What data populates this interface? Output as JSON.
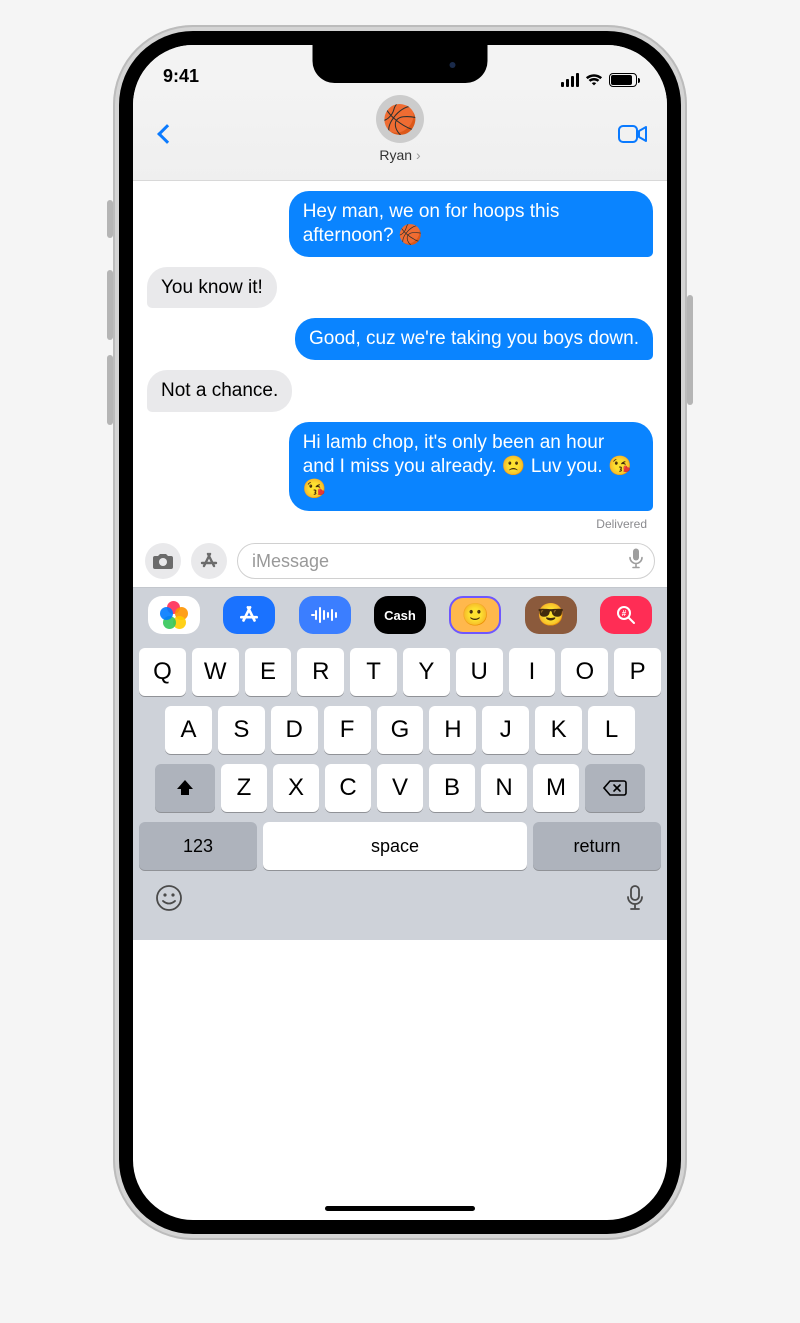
{
  "status": {
    "time": "9:41"
  },
  "header": {
    "contact_name": "Ryan",
    "avatar_emoji": "🏀"
  },
  "messages": [
    {
      "side": "sent",
      "text": "Hey man, we on for hoops this afternoon? 🏀"
    },
    {
      "side": "recv",
      "text": "You know it!"
    },
    {
      "side": "sent",
      "text": "Good, cuz we're taking you boys down."
    },
    {
      "side": "recv",
      "text": "Not a chance."
    },
    {
      "side": "sent",
      "text": "Hi lamb chop, it's only been an hour and I miss you already. 🙁 Luv you. 😘😘"
    }
  ],
  "delivered_label": "Delivered",
  "input": {
    "placeholder": "iMessage"
  },
  "app_strip": {
    "cash_label": "Cash"
  },
  "keyboard": {
    "row1": [
      "Q",
      "W",
      "E",
      "R",
      "T",
      "Y",
      "U",
      "I",
      "O",
      "P"
    ],
    "row2": [
      "A",
      "S",
      "D",
      "F",
      "G",
      "H",
      "J",
      "K",
      "L"
    ],
    "row3": [
      "Z",
      "X",
      "C",
      "V",
      "B",
      "N",
      "M"
    ],
    "k123": "123",
    "space": "space",
    "return": "return"
  }
}
